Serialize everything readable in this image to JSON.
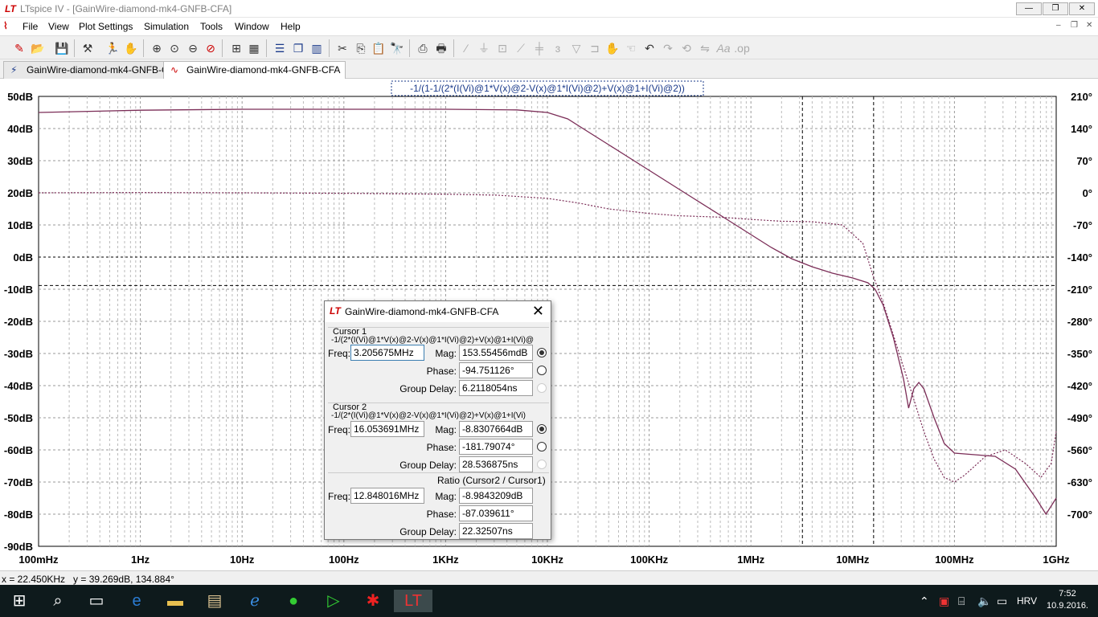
{
  "window": {
    "title": "LTspice IV - [GainWire-diamond-mk4-GNFB-CFA]",
    "minimize": "—",
    "restore": "❐",
    "close": "✕"
  },
  "menu": {
    "items": [
      "File",
      "View",
      "Plot Settings",
      "Simulation",
      "Tools",
      "Window",
      "Help"
    ],
    "mdi": [
      "‒",
      "❐",
      "✕"
    ]
  },
  "toolbar": {
    "icons": [
      "new-schematic-icon",
      "open-icon",
      "save-icon",
      "control-panel-icon",
      "run-icon",
      "halt-icon",
      "zoom-in-icon",
      "zoom-fit-icon",
      "zoom-out-icon",
      "zoom-cancel-icon",
      "autorange-icon",
      "grid-icon",
      "tile-horizontal-icon",
      "cascade-icon",
      "tile-vertical-icon",
      "cut-icon",
      "copy-icon",
      "paste-icon",
      "find-icon",
      "print-setup-icon",
      "print-icon",
      "wire-icon",
      "ground-icon",
      "label-net-icon",
      "resistor-icon",
      "capacitor-icon",
      "inductor-icon",
      "diode-icon",
      "component-icon",
      "move-icon",
      "drag-icon",
      "undo-icon",
      "redo-icon",
      "rotate-icon",
      "mirror-icon",
      "text-icon",
      "spice-directive-icon"
    ]
  },
  "tabs": [
    {
      "label": "GainWire-diamond-mk4-GNFB-CFA",
      "kind": "schematic"
    },
    {
      "label": "GainWire-diamond-mk4-GNFB-CFA",
      "kind": "waveform"
    }
  ],
  "plot": {
    "trace_label": "-1/(1-1/(2*(I(Vi)@1*V(x)@2-V(x)@1*I(Vi)@2)+V(x)@1+I(Vi)@2))",
    "trace_color": "#7b2d57",
    "left_axis": [
      "50dB",
      "40dB",
      "30dB",
      "20dB",
      "10dB",
      "0dB",
      "-10dB",
      "-20dB",
      "-30dB",
      "-40dB",
      "-50dB",
      "-60dB",
      "-70dB",
      "-80dB",
      "-90dB"
    ],
    "right_axis": [
      "210°",
      "140°",
      "70°",
      "0°",
      "-70°",
      "-140°",
      "-210°",
      "-280°",
      "-350°",
      "-420°",
      "-490°",
      "-560°",
      "-630°",
      "-700°"
    ],
    "x_axis": [
      "100mHz",
      "1Hz",
      "10Hz",
      "100Hz",
      "1KHz",
      "10KHz",
      "100KHz",
      "1MHz",
      "10MHz",
      "100MHz",
      "1GHz"
    ],
    "cursor1_freq_log": 6.506,
    "cursor2_freq_log": 7.2056
  },
  "dialog": {
    "title": "GainWire-diamond-mk4-GNFB-CFA",
    "cursor1": {
      "label": "Cursor 1",
      "expr": "-1/(2*(I(Vi)@1*V(x)@2-V(x)@1*I(Vi)@2)+V(x)@1+I(Vi)@",
      "freq_label": "Freq:",
      "freq": "3.205675MHz",
      "mag_label": "Mag:",
      "mag": "153.55456mdB",
      "phase_label": "Phase:",
      "phase": "-94.751126°",
      "gd_label": "Group Delay:",
      "gd": "6.2118054ns"
    },
    "cursor2": {
      "label": "Cursor 2",
      "expr": "-1/(2*(I(Vi)@1*V(x)@2-V(x)@1*I(Vi)@2)+V(x)@1+I(Vi)",
      "freq_label": "Freq:",
      "freq": "16.053691MHz",
      "mag_label": "Mag:",
      "mag": "-8.8307664dB",
      "phase_label": "Phase:",
      "phase": "-181.79074°",
      "gd_label": "Group Delay:",
      "gd": "28.536875ns"
    },
    "ratio": {
      "label": "Ratio (Cursor2 / Cursor1)",
      "freq_label": "Freq:",
      "freq": "12.848016MHz",
      "mag_label": "Mag:",
      "mag": "-8.9843209dB",
      "phase_label": "Phase:",
      "phase": "-87.039611°",
      "gd_label": "Group Delay:",
      "gd": "22.32507ns"
    }
  },
  "status": {
    "text": "x = 22.450KHz   y = 39.269dB, 134.884°"
  },
  "taskbar": {
    "language": "HRV",
    "time": "7:52",
    "date": "10.9.2016."
  }
}
